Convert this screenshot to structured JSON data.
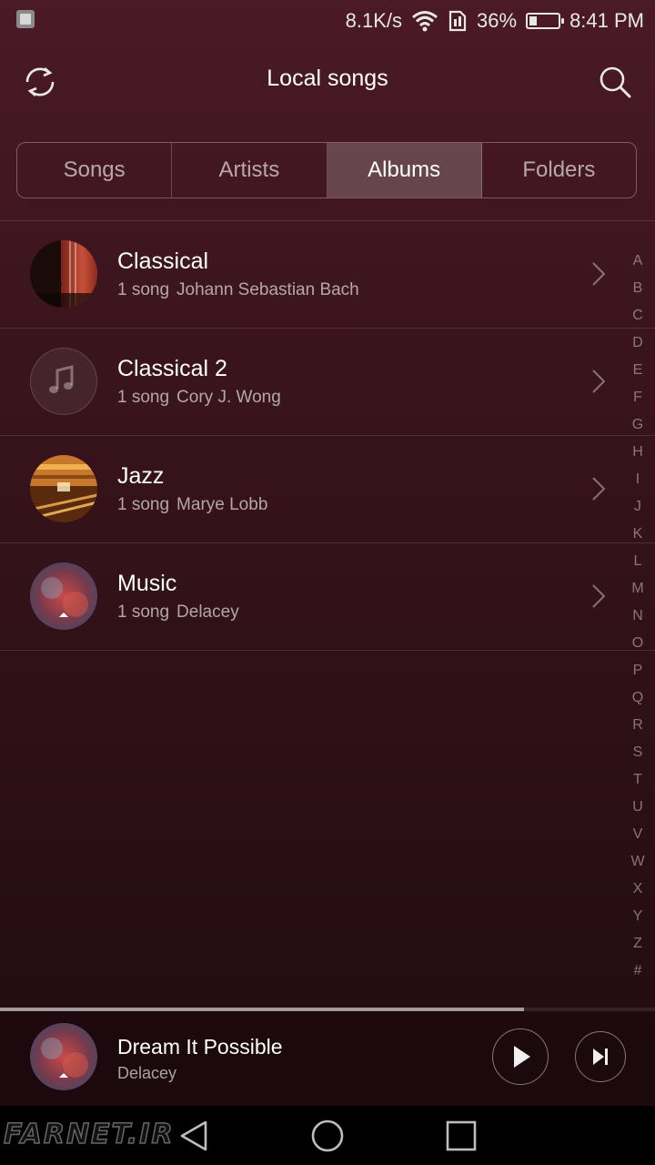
{
  "status_bar": {
    "net_speed": "8.1K/s",
    "battery_percent": "36%",
    "battery_level": 0.36,
    "time": "8:41 PM"
  },
  "header": {
    "title": "Local songs"
  },
  "tabs": [
    {
      "label": "Songs",
      "active": false
    },
    {
      "label": "Artists",
      "active": false
    },
    {
      "label": "Albums",
      "active": true
    },
    {
      "label": "Folders",
      "active": false
    }
  ],
  "albums": [
    {
      "title": "Classical",
      "count": "1 song",
      "artist": "Johann Sebastian Bach",
      "art": "cello-art"
    },
    {
      "title": "Classical 2",
      "count": "1 song",
      "artist": "Cory J. Wong",
      "art": "music-note-placeholder"
    },
    {
      "title": "Jazz",
      "count": "1 song",
      "artist": "Marye Lobb",
      "art": "library-hall-art"
    },
    {
      "title": "Music",
      "count": "1 song",
      "artist": "Delacey",
      "art": "nebula-art"
    }
  ],
  "alpha_index": [
    "A",
    "B",
    "C",
    "D",
    "E",
    "F",
    "G",
    "H",
    "I",
    "J",
    "K",
    "L",
    "M",
    "N",
    "O",
    "P",
    "Q",
    "R",
    "S",
    "T",
    "U",
    "V",
    "W",
    "X",
    "Y",
    "Z",
    "#"
  ],
  "now_playing": {
    "title": "Dream It Possible",
    "artist": "Delacey",
    "progress": 0.8
  },
  "watermark": "FARNET.IR",
  "colors": {
    "background_top": "#4a1a26",
    "background_bottom": "#1f0a10",
    "active_tab": "#6a3c46",
    "text_secondary": "#b8a8ab"
  }
}
